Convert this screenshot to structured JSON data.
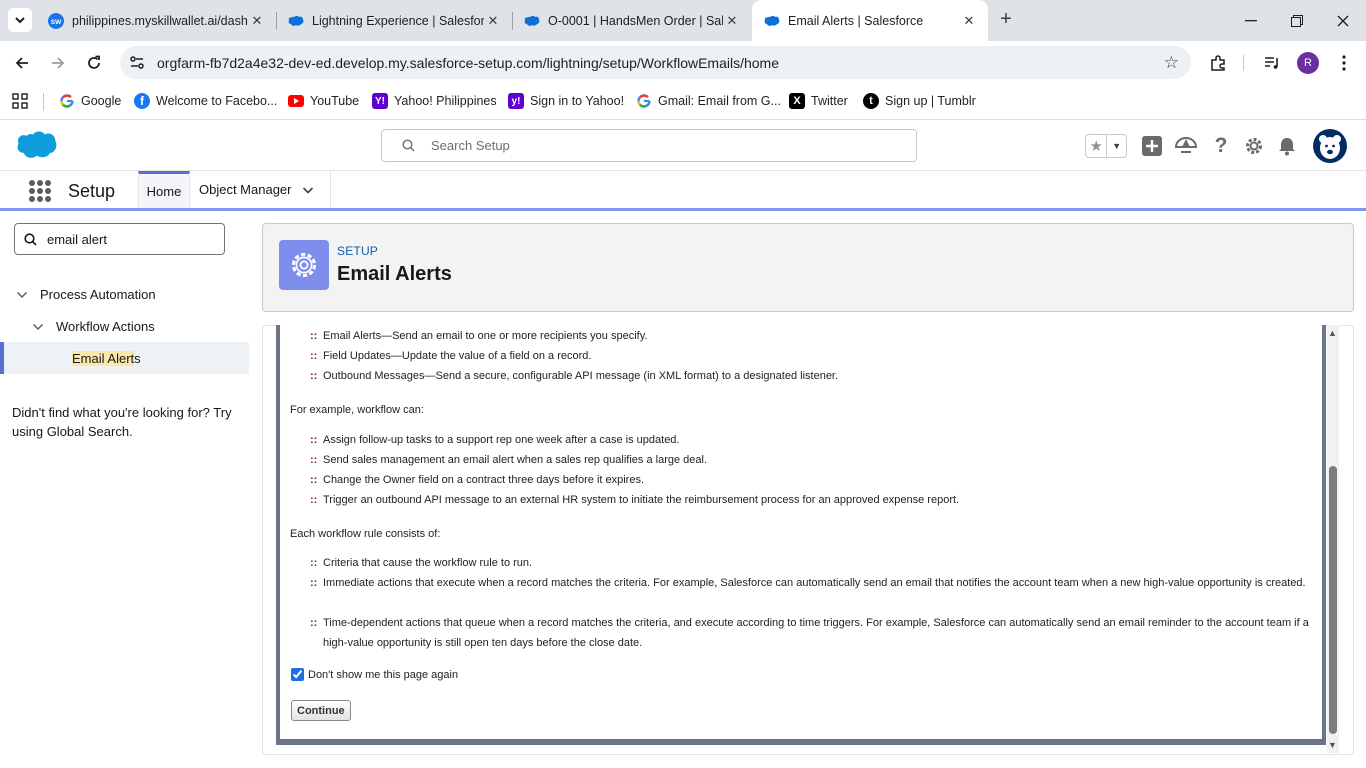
{
  "browser": {
    "tabs": [
      {
        "title": "philippines.myskillwallet.ai/dash",
        "favicon": "sw-icon"
      },
      {
        "title": "Lightning Experience | Salesforc",
        "favicon": "salesforce-cloud-icon"
      },
      {
        "title": "O-0001 | HandsMen Order | Sal",
        "favicon": "salesforce-cloud-icon"
      },
      {
        "title": "Email Alerts | Salesforce",
        "favicon": "salesforce-cloud-icon"
      }
    ],
    "tab_sw_text": "SW",
    "url": "orgfarm-fb7d2a4e32-dev-ed.develop.my.salesforce-setup.com/lightning/setup/WorkflowEmails/home",
    "profile_initial": "R",
    "bookmarks": [
      {
        "label": "Google",
        "icon": "google-icon"
      },
      {
        "label": "Welcome to Facebo...",
        "icon": "facebook-icon"
      },
      {
        "label": "YouTube",
        "icon": "youtube-icon"
      },
      {
        "label": "Yahoo! Philippines",
        "icon": "yahoo-icon"
      },
      {
        "label": "Sign in to Yahoo!",
        "icon": "yahoo-icon"
      },
      {
        "label": "Gmail: Email from G...",
        "icon": "google-icon"
      },
      {
        "label": "Twitter",
        "icon": "x-icon"
      },
      {
        "label": "Sign up | Tumblr",
        "icon": "tumblr-icon"
      }
    ]
  },
  "salesforce": {
    "search_placeholder": "Search Setup",
    "app_name": "Setup",
    "nav_tabs": {
      "home": "Home",
      "object_manager": "Object Manager"
    },
    "accent_color": "#5a6fd4"
  },
  "sidebar": {
    "quick_find_value": "email alert",
    "tree": {
      "level1": "Process Automation",
      "level2": "Workflow Actions",
      "selected_highlight": "Email Alert",
      "selected_rest": "s"
    },
    "help_text": "Didn't find what you're looking for? Try using Global Search."
  },
  "page_header": {
    "eyebrow": "SETUP",
    "title": "Email Alerts"
  },
  "content": {
    "action_types": [
      "Email Alerts—Send an email to one or more recipients you specify.",
      "Field Updates—Update the value of a field on a record.",
      "Outbound Messages—Send a secure, configurable API message (in XML format) to a designated listener."
    ],
    "example_heading": "For example, workflow can:",
    "examples": [
      "Assign follow-up tasks to a support rep one week after a case is updated.",
      "Send sales management an email alert when a sales rep qualifies a large deal.",
      "Change the Owner field on a contract three days before it expires.",
      "Trigger an outbound API message to an external HR system to initiate the reimbursement process for an approved expense report."
    ],
    "rule_heading": "Each workflow rule consists of:",
    "rule_parts": [
      "Criteria that cause the workflow rule to run.",
      "Immediate actions that execute when a record matches the criteria. For example, Salesforce can automatically send an email that notifies the account team when a new high-value opportunity is created.",
      "Time-dependent actions that queue when a record matches the criteria, and execute according to time triggers. For example, Salesforce can automatically send an email reminder to the account team if a high-value opportunity is still open ten days before the close date."
    ],
    "checkbox_label": "Don't show me this page again",
    "checkbox_checked": true,
    "continue_label": "Continue"
  }
}
